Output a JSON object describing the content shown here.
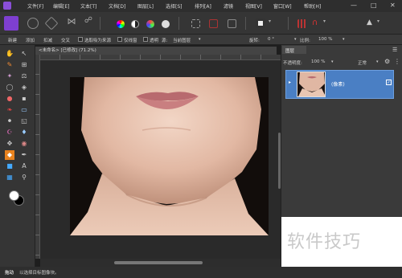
{
  "menu": {
    "items": [
      "文件[F]",
      "编辑[E]",
      "文本[T]",
      "文档[D]",
      "图层[L]",
      "选择[S]",
      "排列[A]",
      "滤镜",
      "视图[V]",
      "窗口[W]",
      "帮助[H]"
    ]
  },
  "context_bar": {
    "new_label": "新建",
    "add_label": "添加",
    "subtract_label": "扣减",
    "intersect_label": "交叉",
    "snap_label": "选取吸为来源",
    "current_only_label": "仅线窗",
    "transparent_label": "透明",
    "source_label": "源:",
    "source_value": "当前图层",
    "rotate_label": "旋转:",
    "rotate_value": "0 °",
    "ratio_label": "比例:",
    "ratio_value": "100 %"
  },
  "document": {
    "tab_title": "<未命名> [已修改] (71.2%)"
  },
  "layers_panel": {
    "tab_label": "图层",
    "opacity_label": "不透明度:",
    "opacity_value": "100 %",
    "blend_value": "正常",
    "layer_name": "(像素)"
  },
  "status": {
    "text_bold": "拖动",
    "text": "以选择目标图像块。"
  },
  "watermark": {
    "text": "软件技巧"
  },
  "colors": {
    "accent": "#4a7fc4",
    "primary_color": "#ffffff",
    "secondary_color": "#000000"
  }
}
